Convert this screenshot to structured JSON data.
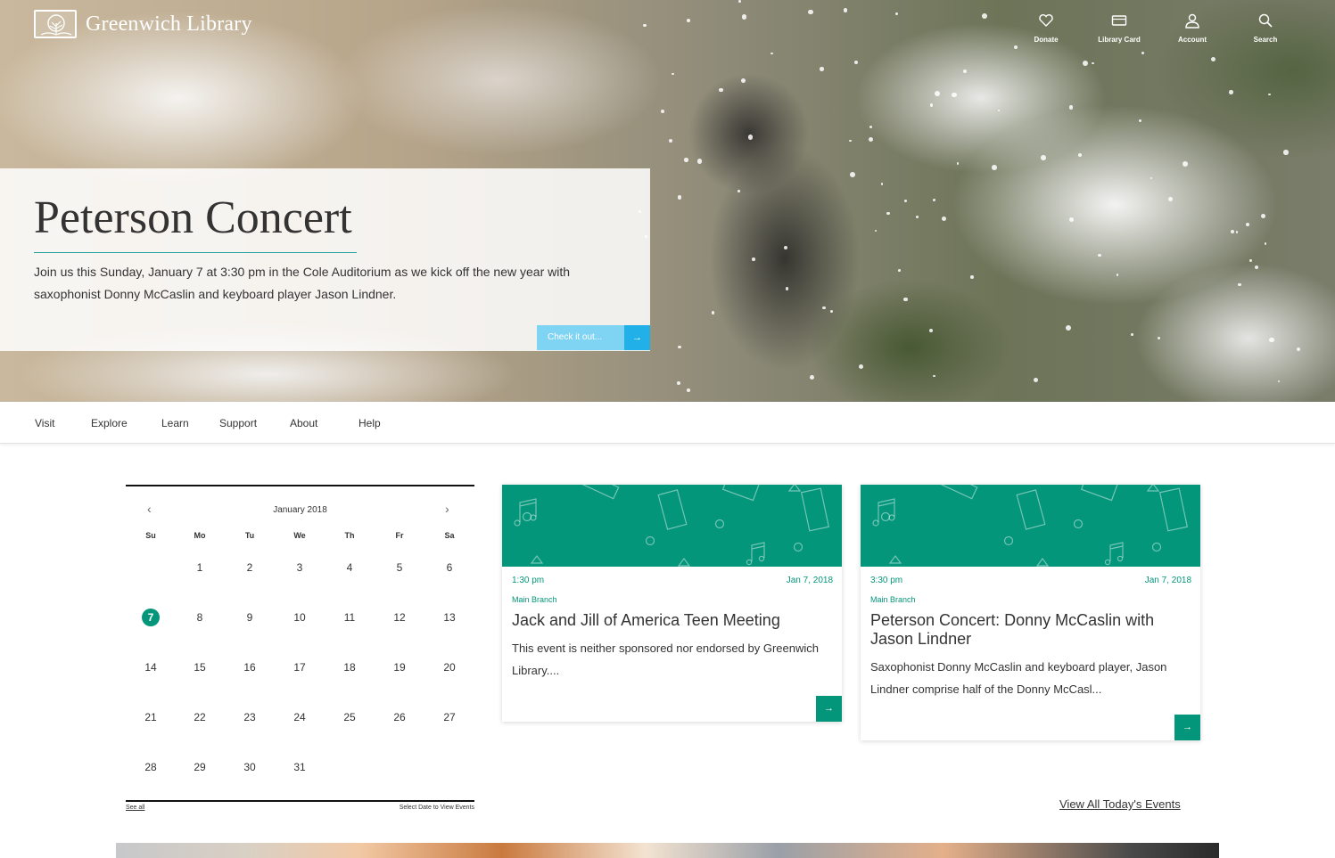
{
  "brand": {
    "name": "Greenwich Library"
  },
  "util_nav": [
    {
      "label": "Donate",
      "icon": "heart-icon"
    },
    {
      "label": "Library Card",
      "icon": "card-icon"
    },
    {
      "label": "Account",
      "icon": "user-icon"
    },
    {
      "label": "Search",
      "icon": "search-icon"
    }
  ],
  "promo": {
    "title": "Peterson Concert",
    "text": "Join us this Sunday, January 7 at 3:30 pm in the Cole Auditorium as we kick off the new year with saxophonist Donny McCaslin and keyboard player Jason Lindner.",
    "button_label": "Check it out...",
    "button_arrow": "→"
  },
  "main_nav": [
    "Visit",
    "Explore",
    "Learn",
    "Support",
    "About",
    "Help"
  ],
  "calendar": {
    "month": "January 2018",
    "prev": "‹",
    "next": "›",
    "weekdays": [
      "Su",
      "Mo",
      "Tu",
      "We",
      "Th",
      "Fr",
      "Sa"
    ],
    "weeks": [
      [
        "",
        "1",
        "2",
        "3",
        "4",
        "5",
        "6"
      ],
      [
        "7",
        "8",
        "9",
        "10",
        "11",
        "12",
        "13"
      ],
      [
        "14",
        "15",
        "16",
        "17",
        "18",
        "19",
        "20"
      ],
      [
        "21",
        "22",
        "23",
        "24",
        "25",
        "26",
        "27"
      ],
      [
        "28",
        "29",
        "30",
        "31",
        "",
        "",
        ""
      ]
    ],
    "selected_day": "7",
    "see_all": "See all",
    "hint": "Select Date to View Events"
  },
  "events": [
    {
      "time": "1:30 pm",
      "date": "Jan 7, 2018",
      "branch": "Main Branch",
      "title": "Jack and Jill of America Teen Meeting",
      "desc": "This event is neither sponsored nor endorsed by Greenwich Library....",
      "arrow": "→"
    },
    {
      "time": "3:30 pm",
      "date": "Jan 7, 2018",
      "branch": "Main Branch",
      "title": "Peterson Concert: Donny McCaslin with Jason Lindner",
      "desc": "Saxophonist Donny McCaslin and keyboard player, Jason Lindner comprise half of the Donny McCasl...",
      "arrow": "→"
    }
  ],
  "view_all_label": "View All Today's Events",
  "colors": {
    "accent_green": "#03967a",
    "button_blue": "#22b0e8",
    "button_light_blue": "#7fd4f4",
    "rule_teal": "#24a39e"
  }
}
